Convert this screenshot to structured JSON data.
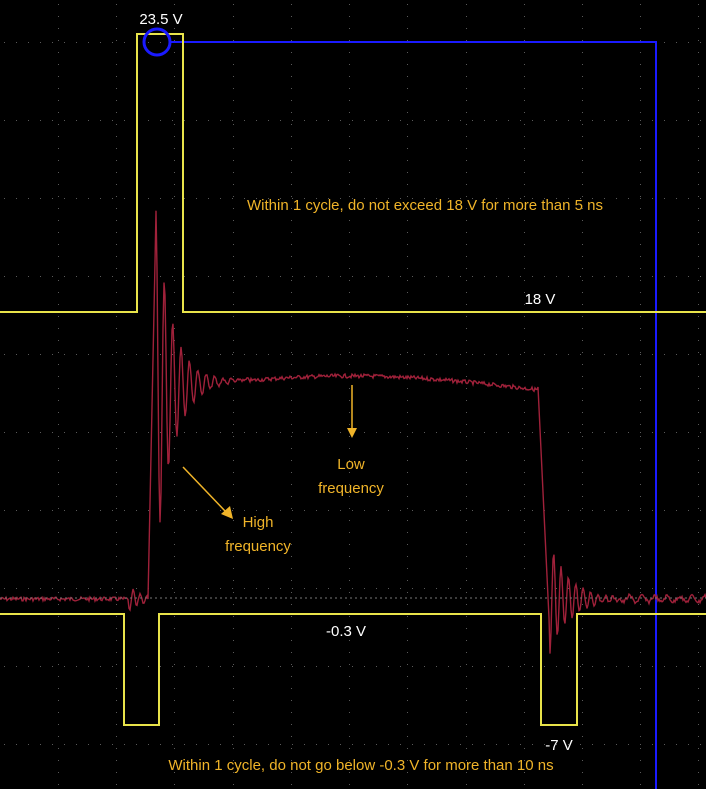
{
  "chart_data": {
    "type": "line",
    "title": "",
    "xlabel": "",
    "ylabel": "",
    "grid": true,
    "limit_mask": {
      "upper_peak_label": "23.5 V",
      "upper_level_label": "18 V",
      "lower_level_label": "-0.3 V",
      "lower_peak_label": "-7 V"
    },
    "signal": {
      "baseline": "low",
      "features": [
        "rising edge with ringing overshoot",
        "slow hump on plateau",
        "falling edge with ringing undershoot"
      ]
    },
    "annotations": {
      "upper_rule": "Within 1 cycle, do not exceed 18 V for more than 5 ns",
      "lower_rule": "Within 1 cycle, do not go below -0.3 V for more than 10 ns",
      "high_freq_line1": "High",
      "high_freq_line2": "frequency",
      "low_freq_line1": "Low",
      "low_freq_line2": "frequency"
    },
    "colors": {
      "mask": "#e8e34a",
      "signal": "#a0213a",
      "annotation": "#f0b429",
      "marker": "#1a1aff",
      "label": "#ffffff"
    }
  }
}
